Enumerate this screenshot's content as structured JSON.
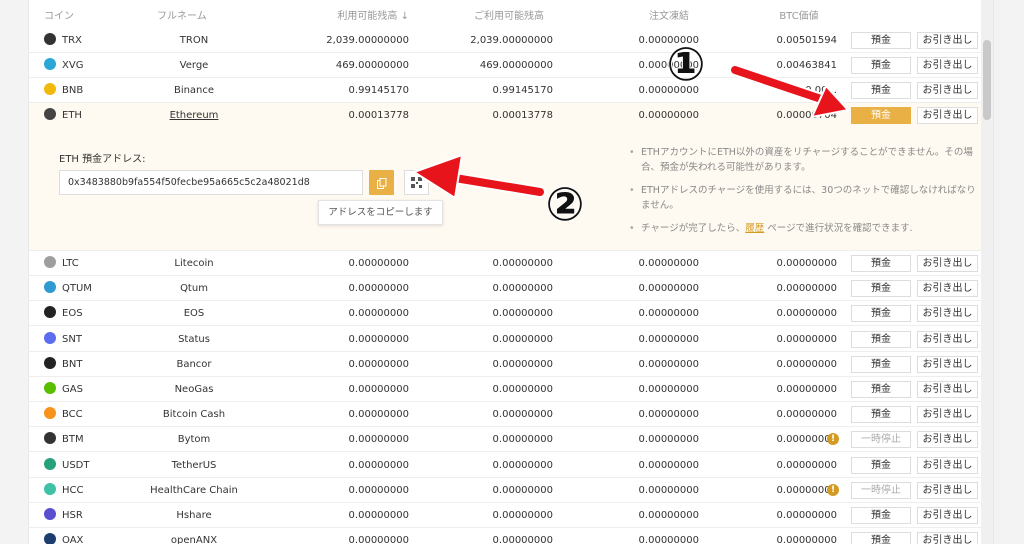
{
  "header": {
    "coin": "コイン",
    "fullname": "フルネーム",
    "available": "利用可能残高",
    "sort_icon": "↓",
    "available2": "ご利用可能残高",
    "in_order": "注文凍結",
    "btc_value": "BTC価値"
  },
  "rows_top": [
    {
      "sym": "TRX",
      "name": "TRON",
      "avail": "2,039.00000000",
      "avail2": "2,039.00000000",
      "order": "0.00000000",
      "btc": "0.00501594",
      "deposit": "預金",
      "withdraw": "お引き出し",
      "icon_color": "#333333",
      "icon": "trx-icon"
    },
    {
      "sym": "XVG",
      "name": "Verge",
      "avail": "469.00000000",
      "avail2": "469.00000000",
      "order": "0.00000000",
      "btc": "0.00463841",
      "deposit": "預金",
      "withdraw": "お引き出し",
      "icon_color": "#2aa7d6",
      "icon": "xvg-icon"
    },
    {
      "sym": "BNB",
      "name": "Binance",
      "avail": "0.99145170",
      "avail2": "0.99145170",
      "order": "0.00000000",
      "btc": "0.00...",
      "deposit": "預金",
      "withdraw": "お引き出し",
      "icon_color": "#f0b90b",
      "icon": "bnb-icon"
    },
    {
      "sym": "ETH",
      "name": "Ethereum",
      "avail": "0.00013778",
      "avail2": "0.00013778",
      "order": "0.00000000",
      "btc": "0.00000704",
      "deposit": "預金",
      "withdraw": "お引き出し",
      "icon_color": "#444444",
      "icon": "eth-icon"
    }
  ],
  "eth_panel": {
    "address_label": "ETH 預金アドレス:",
    "address": "0x3483880b9fa554f50fecbe95a665c5c2a48021d8",
    "copy_icon": "copy-icon",
    "qr_icon": "qr-icon",
    "tooltip": "アドレスをコピーします",
    "note1": "ETHアカウントにETH以外の資産をリチャージすることができません。その場合、預金が失われる可能性があります。",
    "note2": "ETHアドレスのチャージを使用するには、30つのネットで確認しなければなりません。",
    "note3_pre": "チャージが完了したら、",
    "note3_link": "履歴",
    "note3_post": " ページで進行状況を確認できます."
  },
  "rows_bottom": [
    {
      "sym": "LTC",
      "name": "Litecoin",
      "avail": "0.00000000",
      "avail2": "0.00000000",
      "order": "0.00000000",
      "btc": "0.00000000",
      "deposit": "預金",
      "withdraw": "お引き出し",
      "icon_color": "#9e9e9e",
      "suspended": false
    },
    {
      "sym": "QTUM",
      "name": "Qtum",
      "avail": "0.00000000",
      "avail2": "0.00000000",
      "order": "0.00000000",
      "btc": "0.00000000",
      "deposit": "預金",
      "withdraw": "お引き出し",
      "icon_color": "#2e9ad0",
      "suspended": false
    },
    {
      "sym": "EOS",
      "name": "EOS",
      "avail": "0.00000000",
      "avail2": "0.00000000",
      "order": "0.00000000",
      "btc": "0.00000000",
      "deposit": "預金",
      "withdraw": "お引き出し",
      "icon_color": "#222222",
      "suspended": false
    },
    {
      "sym": "SNT",
      "name": "Status",
      "avail": "0.00000000",
      "avail2": "0.00000000",
      "order": "0.00000000",
      "btc": "0.00000000",
      "deposit": "預金",
      "withdraw": "お引き出し",
      "icon_color": "#5b6dee",
      "suspended": false
    },
    {
      "sym": "BNT",
      "name": "Bancor",
      "avail": "0.00000000",
      "avail2": "0.00000000",
      "order": "0.00000000",
      "btc": "0.00000000",
      "deposit": "預金",
      "withdraw": "お引き出し",
      "icon_color": "#222222",
      "suspended": false
    },
    {
      "sym": "GAS",
      "name": "NeoGas",
      "avail": "0.00000000",
      "avail2": "0.00000000",
      "order": "0.00000000",
      "btc": "0.00000000",
      "deposit": "預金",
      "withdraw": "お引き出し",
      "icon_color": "#58bf00",
      "suspended": false
    },
    {
      "sym": "BCC",
      "name": "Bitcoin Cash",
      "avail": "0.00000000",
      "avail2": "0.00000000",
      "order": "0.00000000",
      "btc": "0.00000000",
      "deposit": "預金",
      "withdraw": "お引き出し",
      "icon_color": "#f7931a",
      "suspended": false
    },
    {
      "sym": "BTM",
      "name": "Bytom",
      "avail": "0.00000000",
      "avail2": "0.00000000",
      "order": "0.00000000",
      "btc": "0.00000000",
      "deposit": "一時停止",
      "withdraw": "お引き出し",
      "icon_color": "#333333",
      "suspended": true
    },
    {
      "sym": "USDT",
      "name": "TetherUS",
      "avail": "0.00000000",
      "avail2": "0.00000000",
      "order": "0.00000000",
      "btc": "0.00000000",
      "deposit": "預金",
      "withdraw": "お引き出し",
      "icon_color": "#26a17b",
      "suspended": false
    },
    {
      "sym": "HCC",
      "name": "HealthCare Chain",
      "avail": "0.00000000",
      "avail2": "0.00000000",
      "order": "0.00000000",
      "btc": "0.00000000",
      "deposit": "一時停止",
      "withdraw": "お引き出し",
      "icon_color": "#3fc1a5",
      "suspended": true
    },
    {
      "sym": "HSR",
      "name": "Hshare",
      "avail": "0.00000000",
      "avail2": "0.00000000",
      "order": "0.00000000",
      "btc": "0.00000000",
      "deposit": "預金",
      "withdraw": "お引き出し",
      "icon_color": "#5a4fcf",
      "suspended": false
    },
    {
      "sym": "OAX",
      "name": "openANX",
      "avail": "0.00000000",
      "avail2": "0.00000000",
      "order": "0.00000000",
      "btc": "0.00000000",
      "deposit": "預金",
      "withdraw": "お引き出し",
      "icon_color": "#1c3d6e",
      "suspended": false
    }
  ],
  "annotations": {
    "marker1": "①",
    "marker2": "②",
    "arrow_color": "#e8141b"
  }
}
